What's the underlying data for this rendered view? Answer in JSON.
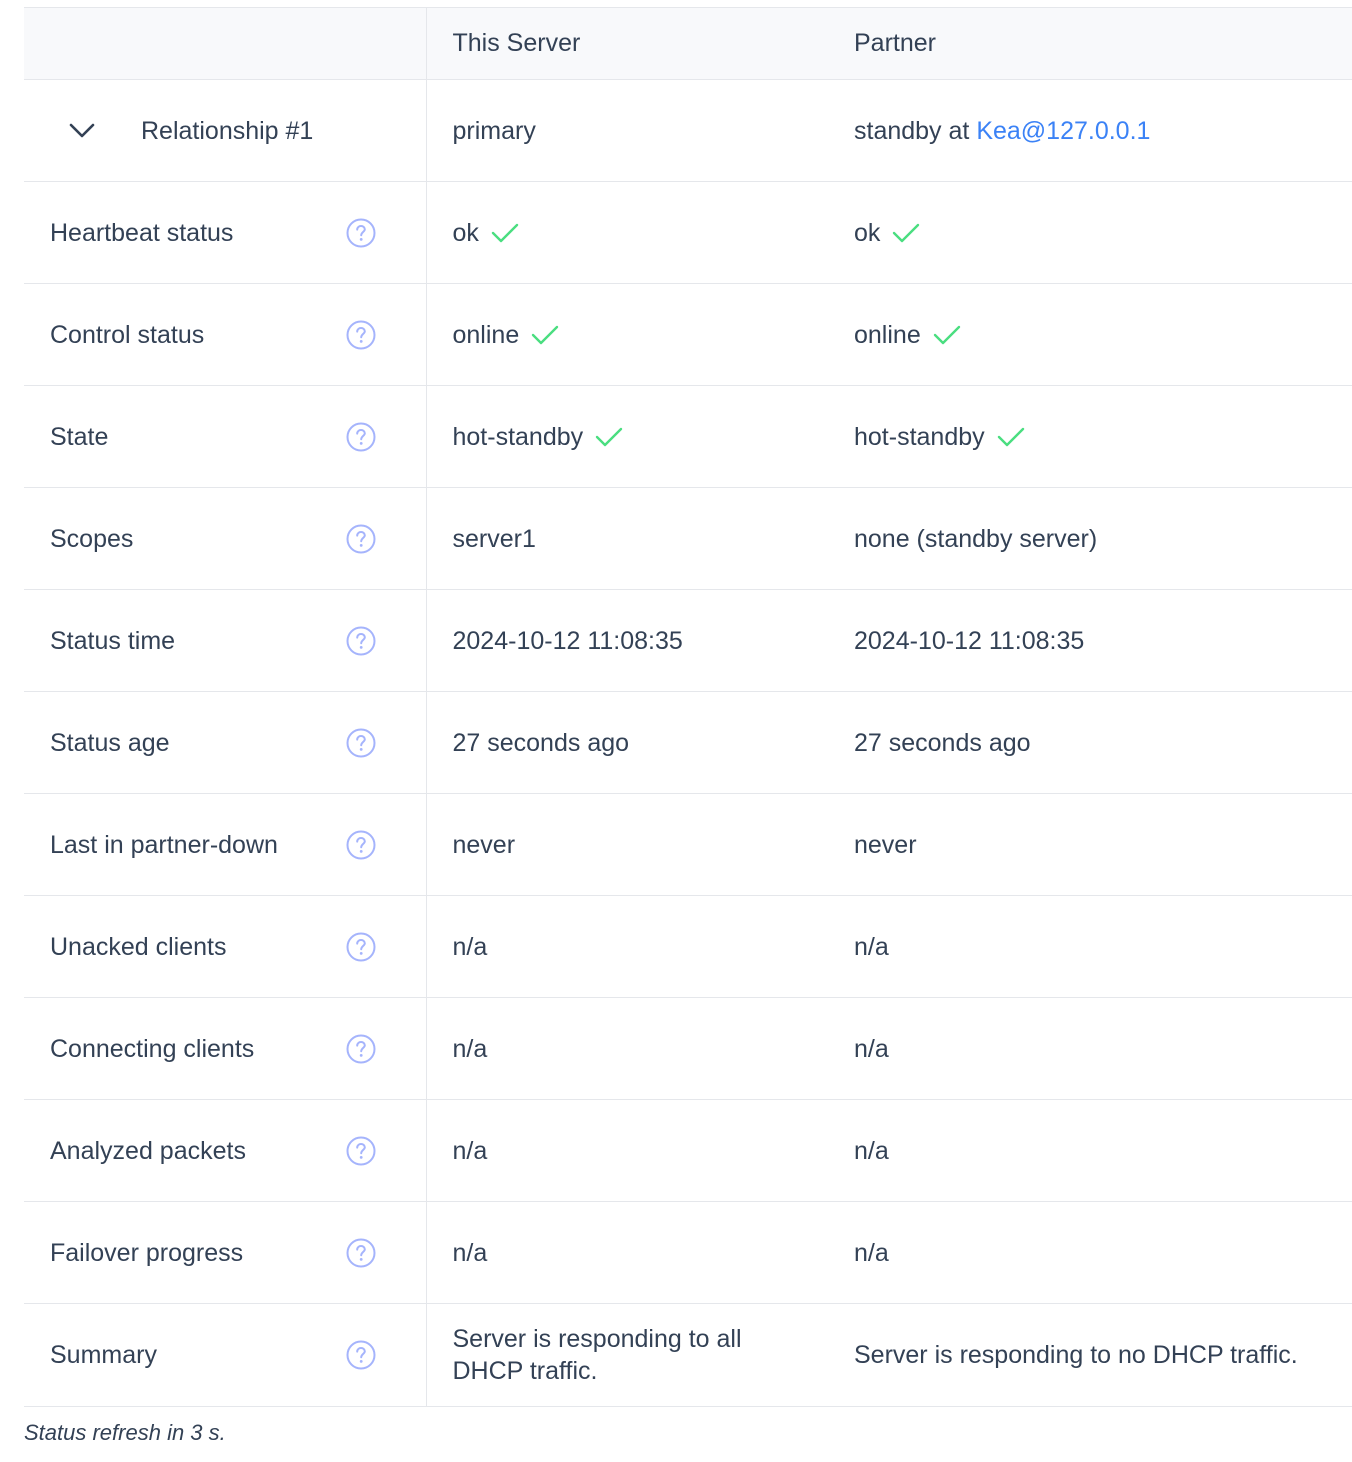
{
  "header": {
    "col_this": "This Server",
    "col_partner": "Partner"
  },
  "relationship": {
    "label": "Relationship #1",
    "this_role": "primary",
    "partner_prefix": "standby at ",
    "partner_link": "Kea@127.0.0.1"
  },
  "rows": [
    {
      "label": "Heartbeat status",
      "this": "ok",
      "partner": "ok",
      "this_ok": true,
      "partner_ok": true
    },
    {
      "label": "Control status",
      "this": "online",
      "partner": "online",
      "this_ok": true,
      "partner_ok": true
    },
    {
      "label": "State",
      "this": "hot-standby",
      "partner": "hot-standby",
      "this_ok": true,
      "partner_ok": true
    },
    {
      "label": "Scopes",
      "this": "server1",
      "partner": "none (standby server)"
    },
    {
      "label": "Status time",
      "this": "2024-10-12 11:08:35",
      "partner": "2024-10-12 11:08:35"
    },
    {
      "label": "Status age",
      "this": "27 seconds ago",
      "partner": "27 seconds ago"
    },
    {
      "label": "Last in partner-down",
      "this": "never",
      "partner": "never"
    },
    {
      "label": "Unacked clients",
      "this": "n/a",
      "partner": "n/a"
    },
    {
      "label": "Connecting clients",
      "this": "n/a",
      "partner": "n/a"
    },
    {
      "label": "Analyzed packets",
      "this": "n/a",
      "partner": "n/a"
    },
    {
      "label": "Failover progress",
      "this": "n/a",
      "partner": "n/a"
    },
    {
      "label": "Summary",
      "this": "Server is responding to all DHCP traffic.",
      "partner": "Server is responding to no DHCP traffic."
    }
  ],
  "footer": {
    "refresh_text": "Status refresh in 3 s."
  },
  "colors": {
    "check": "#4ade80",
    "help_icon": "#a5b4fc",
    "link": "#3b82f6"
  },
  "icons": {
    "chevron": "chevron-down-icon",
    "help": "question-circle-icon",
    "check": "check-icon"
  }
}
